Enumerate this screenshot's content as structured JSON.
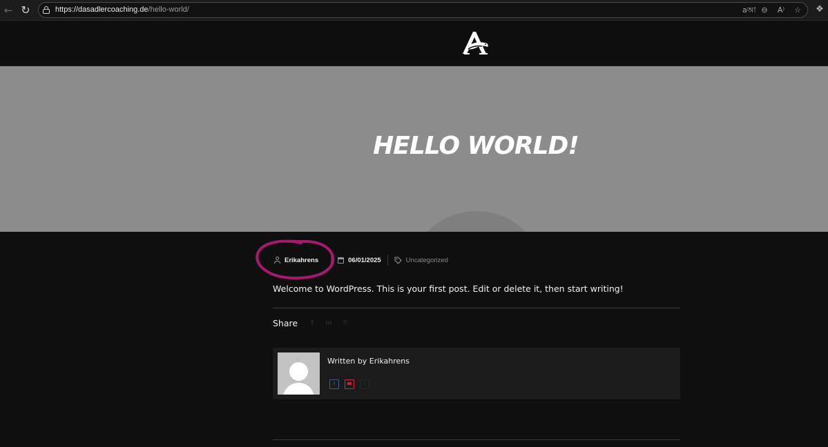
{
  "browser": {
    "url_host": "https://dasadlercoaching.de",
    "url_path": "/hello-world/",
    "back_icon": "arrow-left-icon",
    "reload_icon": "reload-icon",
    "tool_icons": [
      "translate-icon",
      "zoom-out-icon",
      "read-aloud-icon",
      "favorite-star-icon"
    ]
  },
  "hero": {
    "title": "HELLO WORLD!"
  },
  "meta": {
    "author": "Erikahrens",
    "date": "06/01/2025",
    "category": "Uncategorized",
    "annotation_color": "#a6196f"
  },
  "post": {
    "content": "Welcome to WordPress. This is your first post. Edit or delete it, then start writing!",
    "share_label": "Share",
    "share_icons": [
      "facebook-icon",
      "linkedin-icon",
      "pinterest-icon"
    ]
  },
  "author_box": {
    "written_by": "Written by Erikahrens",
    "social": [
      "facebook-icon",
      "email-icon",
      "x-icon"
    ]
  },
  "colors": {
    "page_bg": "#0f0f0f",
    "hero_bg": "#8c8c8c",
    "author_box_bg": "#1b1b1b"
  }
}
